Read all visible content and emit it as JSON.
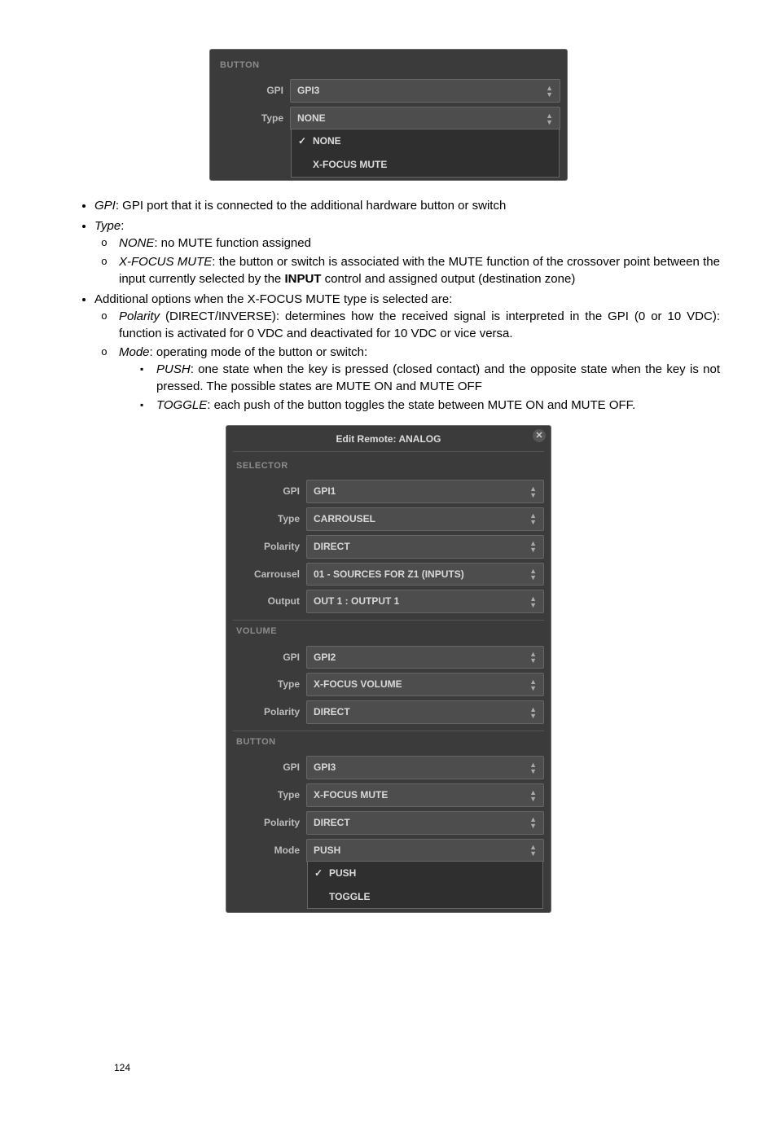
{
  "panel1": {
    "title": "BUTTON",
    "rows": {
      "gpi": {
        "label": "GPI",
        "value": "GPI3"
      },
      "type": {
        "label": "Type",
        "value": "NONE"
      }
    },
    "type_options": [
      "NONE",
      "X-FOCUS MUTE"
    ]
  },
  "bullets": {
    "gpi_outer": "GPI",
    "gpi_rest": ": GPI port that it is connected to the additional hardware button or switch",
    "type_outer": "Type",
    "type_rest": ":",
    "none_em": "NONE",
    "none_rest": ": no MUTE function assigned",
    "xfocus_em": "X-FOCUS MUTE",
    "xfocus_rest1": ": the button or switch is associated with the MUTE function of the crossover point between the input currently selected by the ",
    "xfocus_input": "INPUT",
    "xfocus_rest2": " control and assigned output (destination zone)",
    "addl": "Additional options when the X-FOCUS MUTE type is selected are:",
    "polarity_em": "Polarity",
    "polarity_rest": " (DIRECT/INVERSE): determines how the received signal is interpreted in the GPI (0 or 10 VDC): function is activated for 0 VDC and deactivated for 10 VDC or vice versa.",
    "mode_em": "Mode",
    "mode_rest": ": operating mode of the button or switch:",
    "push_em": "PUSH",
    "push_rest": ": one state when the key is pressed (closed contact) and the opposite state when the key is not pressed. The possible states are MUTE ON and MUTE OFF",
    "toggle_em": "TOGGLE",
    "toggle_rest": ": each push of the button toggles the state between MUTE ON and MUTE OFF."
  },
  "panel2": {
    "dialog_title": "Edit Remote: ANALOG",
    "sections": {
      "selector": {
        "title": "SELECTOR",
        "rows": {
          "gpi": {
            "label": "GPI",
            "value": "GPI1"
          },
          "type": {
            "label": "Type",
            "value": "CARROUSEL"
          },
          "polarity": {
            "label": "Polarity",
            "value": "DIRECT"
          },
          "carrousel": {
            "label": "Carrousel",
            "value": "01 - SOURCES FOR Z1 (INPUTS)"
          },
          "output": {
            "label": "Output",
            "value": "OUT 1 : OUTPUT 1"
          }
        }
      },
      "volume": {
        "title": "VOLUME",
        "rows": {
          "gpi": {
            "label": "GPI",
            "value": "GPI2"
          },
          "type": {
            "label": "Type",
            "value": "X-FOCUS VOLUME"
          },
          "polarity": {
            "label": "Polarity",
            "value": "DIRECT"
          }
        }
      },
      "button": {
        "title": "BUTTON",
        "rows": {
          "gpi": {
            "label": "GPI",
            "value": "GPI3"
          },
          "type": {
            "label": "Type",
            "value": "X-FOCUS MUTE"
          },
          "polarity": {
            "label": "Polarity",
            "value": "DIRECT"
          },
          "mode": {
            "label": "Mode",
            "value": "PUSH"
          }
        },
        "mode_options": [
          "PUSH",
          "TOGGLE"
        ]
      }
    }
  },
  "page_number": "124"
}
